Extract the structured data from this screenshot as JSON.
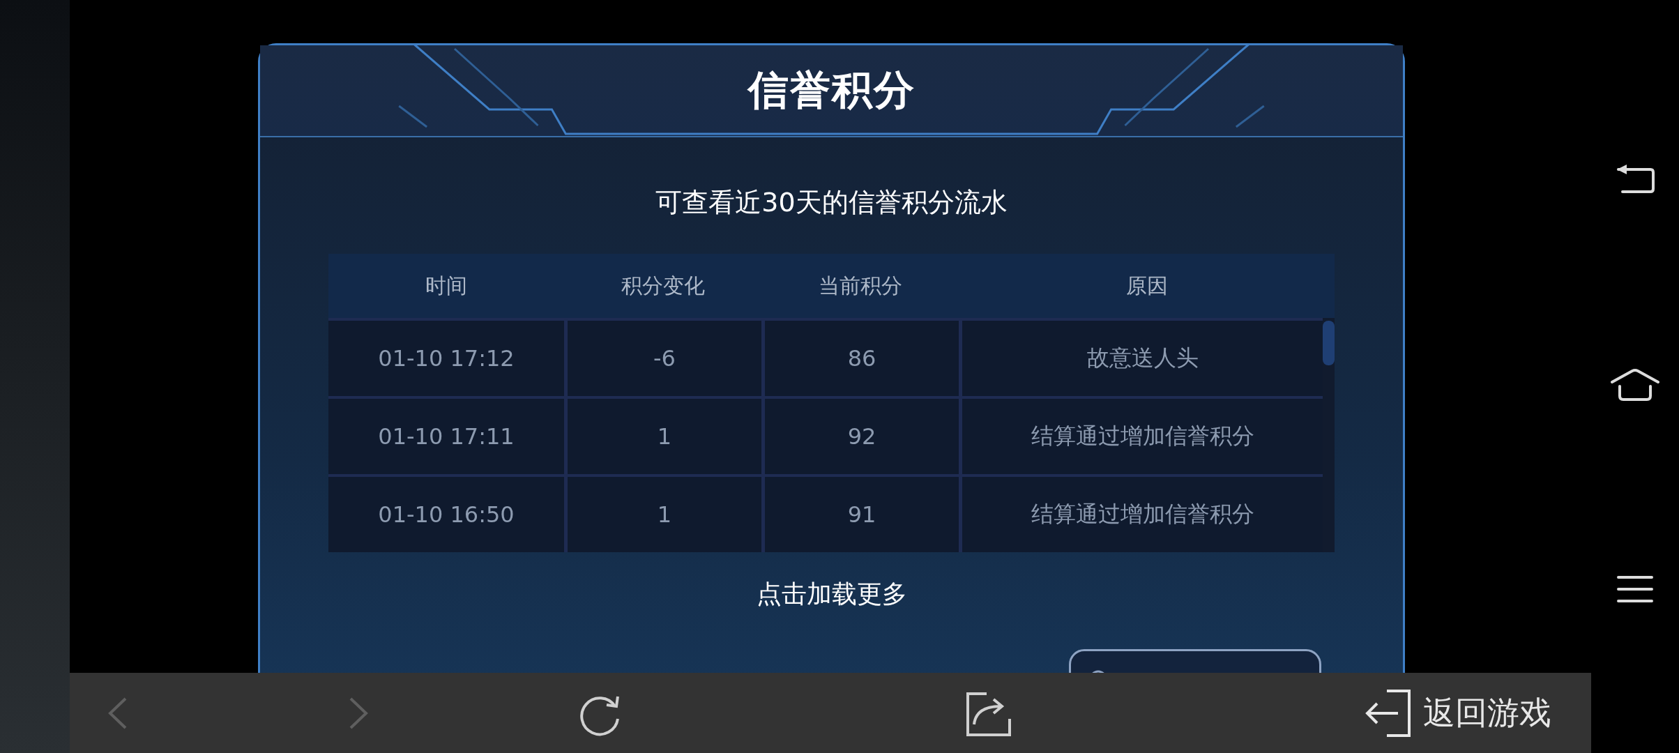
{
  "dialog": {
    "title": "信誉积分",
    "subtitle": "可查看近30天的信誉积分流水"
  },
  "table": {
    "columns": [
      "时间",
      "积分变化",
      "当前积分",
      "原因"
    ],
    "rows": [
      {
        "time": "01-10  17:12",
        "change": "-6",
        "current": "86",
        "reason": "故意送人头"
      },
      {
        "time": "01-10  17:11",
        "change": "1",
        "current": "92",
        "reason": "结算通过增加信誉积分"
      },
      {
        "time": "01-10  16:50",
        "change": "1",
        "current": "91",
        "reason": "结算通过增加信誉积分"
      }
    ]
  },
  "load_more": "点击加载更多",
  "browser_bar": {
    "back_disabled": true,
    "forward_disabled": true,
    "return_label": "返回游戏"
  }
}
